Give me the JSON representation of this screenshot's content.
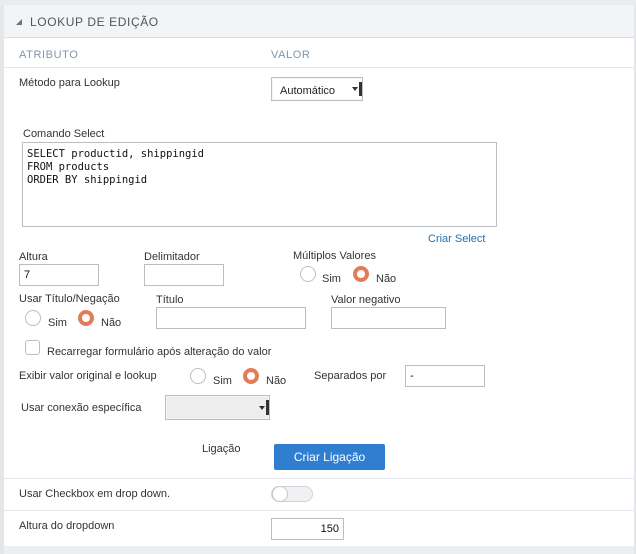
{
  "section": {
    "title": "LOOKUP DE EDIÇÃO"
  },
  "columns": {
    "attribute": "ATRIBUTO",
    "value": "VALOR"
  },
  "lookup_method": {
    "label": "Método para Lookup",
    "value": "Automático"
  },
  "select_command": {
    "label": "Comando Select",
    "value": "SELECT productid, shippingid\nFROM products\nORDER BY shippingid",
    "create_link": "Criar Select"
  },
  "height": {
    "label": "Altura",
    "value": "7"
  },
  "delimiter": {
    "label": "Delimitador",
    "value": ""
  },
  "multiple_values": {
    "label": "Múltiplos Valores",
    "yes": "Sim",
    "no": "Não",
    "selected": "no"
  },
  "title_negation": {
    "label": "Usar Título/Negação",
    "yes": "Sim",
    "no": "Não",
    "selected": "no"
  },
  "title_field": {
    "label": "Título",
    "value": ""
  },
  "negative_value": {
    "label": "Valor negativo",
    "value": ""
  },
  "reload_form": {
    "label": "Recarregar formulário após alteração do valor",
    "checked": false
  },
  "show_original": {
    "label": "Exibir valor original e lookup",
    "yes": "Sim",
    "no": "Não",
    "selected": "no"
  },
  "separated_by": {
    "label": "Separados por",
    "value": "-"
  },
  "specific_connection": {
    "label": "Usar conexão específica",
    "value": ""
  },
  "link_section": {
    "label": "Ligação",
    "button": "Criar Ligação"
  },
  "checkbox_dropdown": {
    "label": "Usar Checkbox em drop down.",
    "enabled": false
  },
  "dropdown_height": {
    "label": "Altura do dropdown",
    "value": "150"
  },
  "colors": {
    "accent": "#2f7ed0",
    "radio_selected": "#e47b57",
    "column_header": "#7f95ad",
    "link": "#2a6db3"
  }
}
